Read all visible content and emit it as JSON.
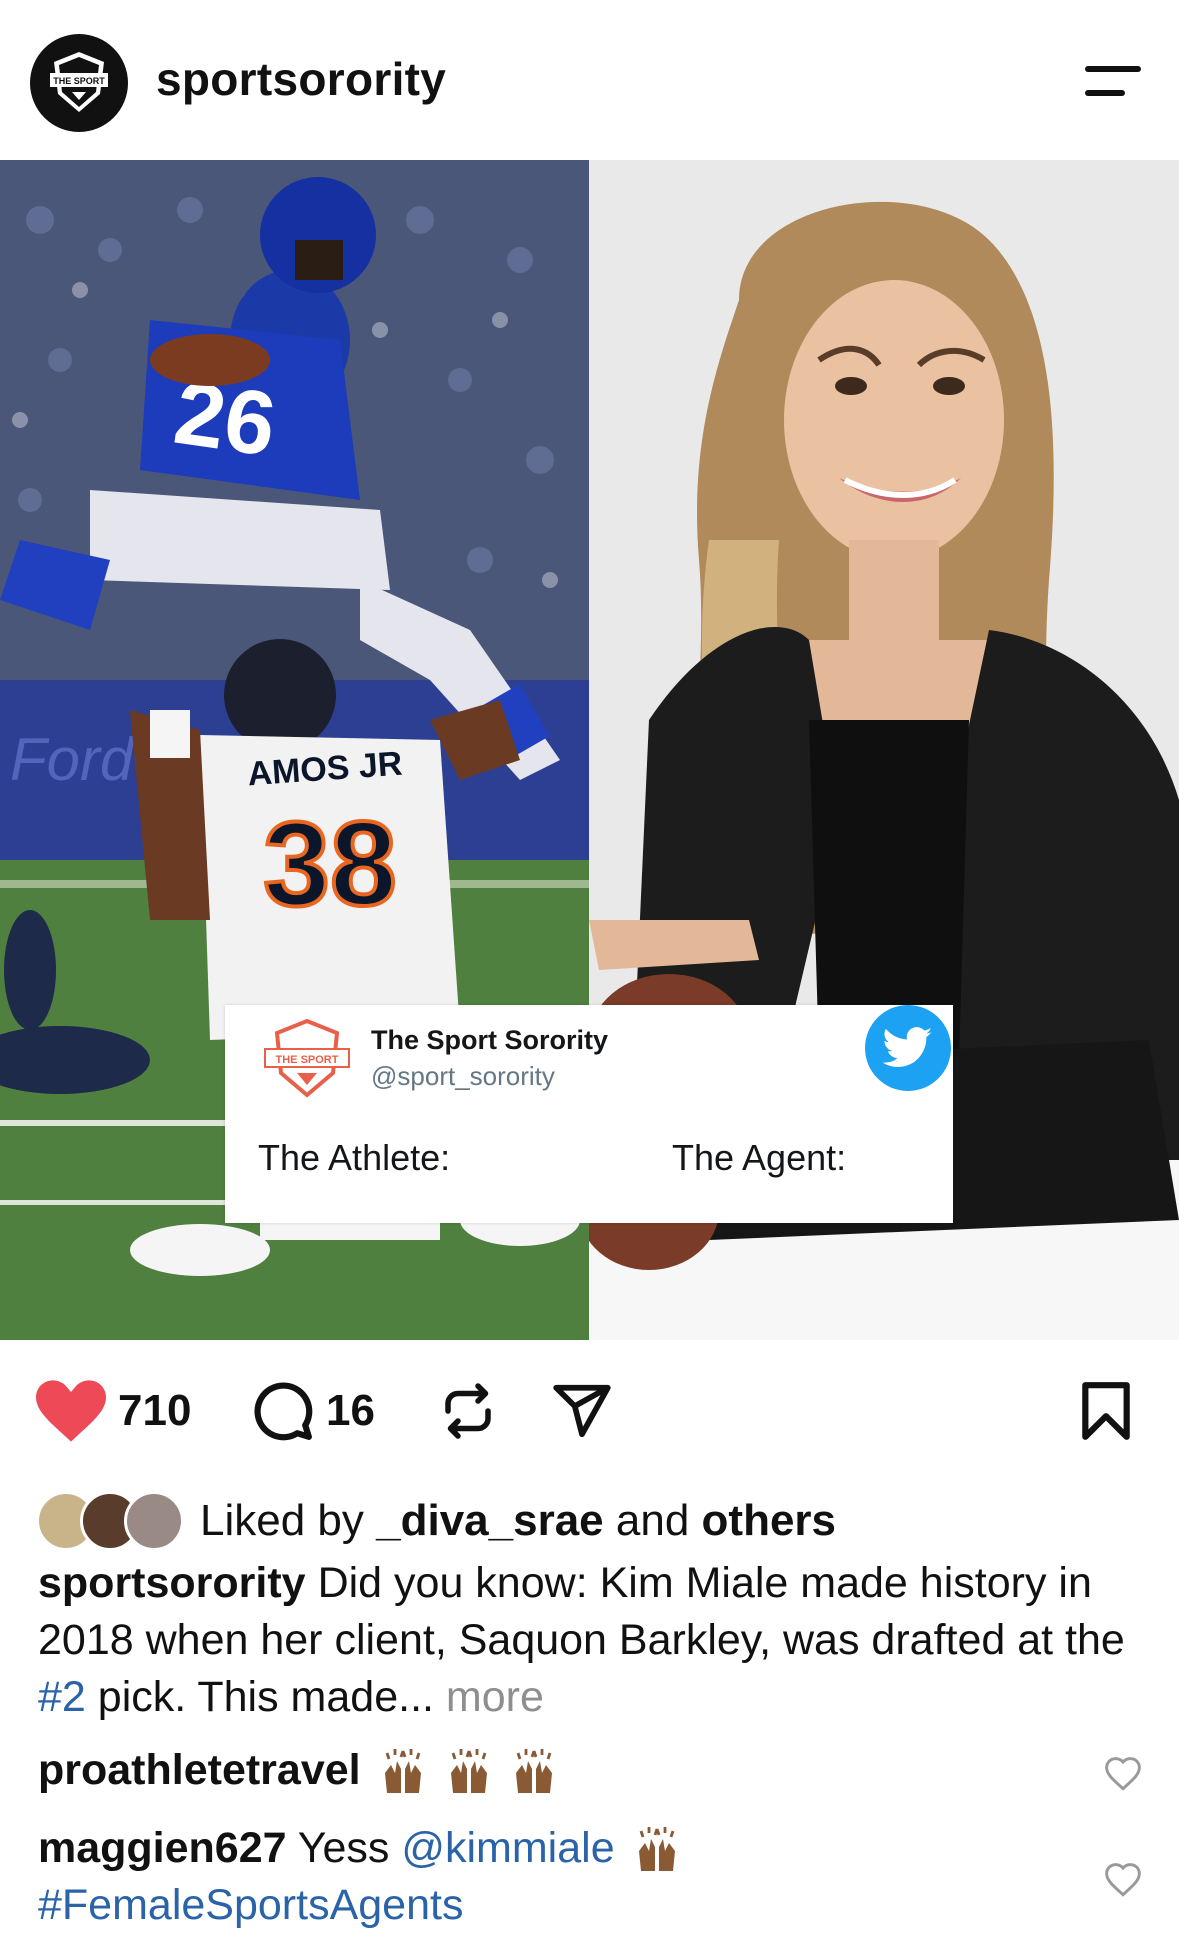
{
  "header": {
    "username": "sportsorority",
    "avatar_text": "THE SPORT"
  },
  "post_image": {
    "left_jersey_name": "AMOS JR",
    "left_jersey_number": "38",
    "tweet": {
      "name": "The Sport Sorority",
      "handle": "@sport_sorority",
      "left_label": "The Athlete:",
      "right_label": "The Agent:",
      "logo_text": "THE SPORT"
    }
  },
  "actions": {
    "likes_count": "710",
    "comments_count": "16",
    "icons": [
      "heart-icon",
      "comment-icon",
      "repost-icon",
      "share-icon",
      "bookmark-icon"
    ],
    "heart_color": "#ed4956"
  },
  "likes_line": {
    "prefix": "Liked by",
    "user": "_diva_srae",
    "middle": "and",
    "suffix": "others"
  },
  "caption": {
    "user": "sportsorority",
    "text_1": "Did you know: Kim Miale made history in 2018 when her client, Saquon Barkley, was drafted at the",
    "hashtag": "#2",
    "text_2": "pick. This made...",
    "more": "more"
  },
  "comments": [
    {
      "user": "proathletetravel",
      "text": "",
      "emoji_count": 3
    },
    {
      "user": "maggien627",
      "text": "Yess",
      "mention": "@kimmiale",
      "hashtag": "#FemaleSportsAgents",
      "emoji_count": 1
    }
  ],
  "colors": {
    "link": "#2b63a9",
    "twitter_blue": "#1da1f2",
    "muted": "#8e8e8e"
  }
}
